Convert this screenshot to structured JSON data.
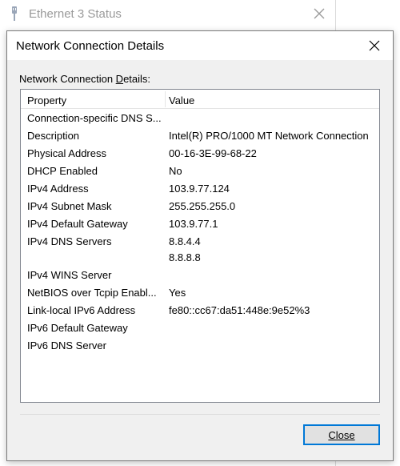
{
  "background_window": {
    "title": "Ethernet 3 Status",
    "icon": "network-adapter-icon",
    "close_icon": "close-icon"
  },
  "dialog": {
    "title": "Network Connection Details",
    "close_icon": "close-icon",
    "section_label": "Network Connection Details:",
    "columns": {
      "property": "Property",
      "value": "Value"
    },
    "rows": [
      {
        "property": "Connection-specific DNS S...",
        "values": [
          ""
        ]
      },
      {
        "property": "Description",
        "values": [
          "Intel(R) PRO/1000 MT Network Connection"
        ]
      },
      {
        "property": "Physical Address",
        "values": [
          "00-16-3E-99-68-22"
        ]
      },
      {
        "property": "DHCP Enabled",
        "values": [
          "No"
        ]
      },
      {
        "property": "IPv4 Address",
        "values": [
          "103.9.77.124"
        ]
      },
      {
        "property": "IPv4 Subnet Mask",
        "values": [
          "255.255.255.0"
        ]
      },
      {
        "property": "IPv4 Default Gateway",
        "values": [
          "103.9.77.1"
        ]
      },
      {
        "property": "IPv4 DNS Servers",
        "values": [
          "8.8.4.4",
          "8.8.8.8"
        ]
      },
      {
        "property": "IPv4 WINS Server",
        "values": [
          ""
        ]
      },
      {
        "property": "NetBIOS over Tcpip Enabl...",
        "values": [
          "Yes"
        ]
      },
      {
        "property": "Link-local IPv6 Address",
        "values": [
          "fe80::cc67:da51:448e:9e52%3"
        ]
      },
      {
        "property": "IPv6 Default Gateway",
        "values": [
          ""
        ]
      },
      {
        "property": "IPv6 DNS Server",
        "values": [
          ""
        ]
      }
    ],
    "close_button": "Close"
  },
  "colors": {
    "dialog_bg": "#f0f0f0",
    "focus_border": "#0078d7",
    "button_bg": "#e1e1e1"
  }
}
